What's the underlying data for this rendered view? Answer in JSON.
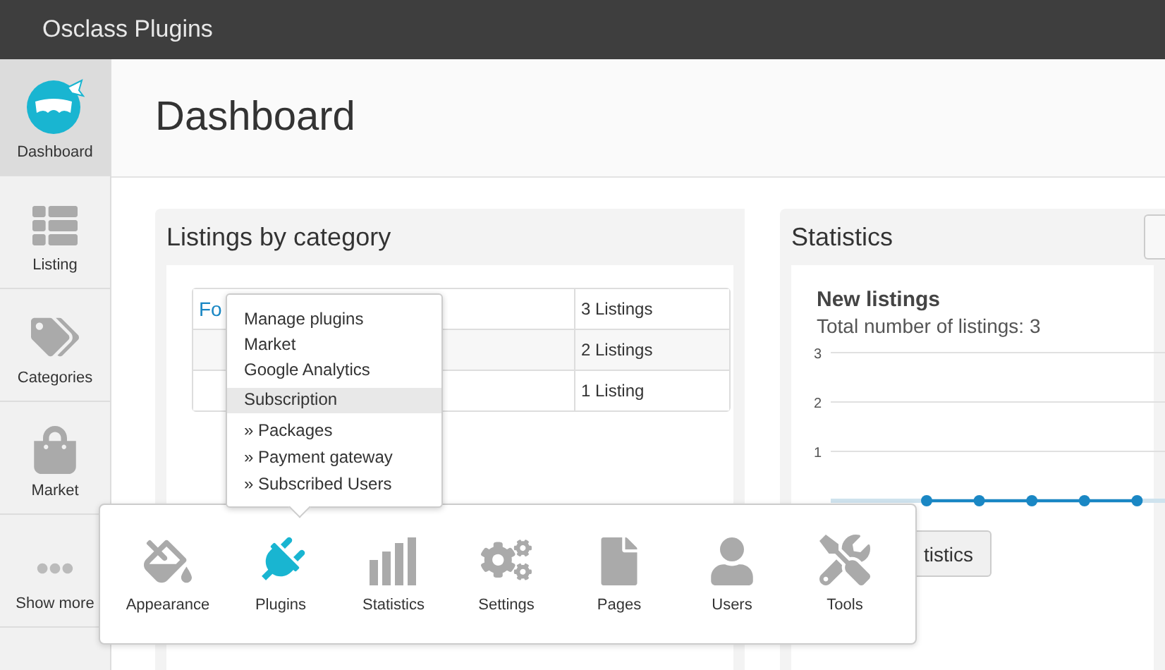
{
  "header": {
    "title": "Osclass Plugins"
  },
  "sidebar": {
    "items": [
      {
        "label": "Dashboard",
        "selected": true
      },
      {
        "label": "Listing",
        "selected": false
      },
      {
        "label": "Categories",
        "selected": false
      },
      {
        "label": "Market",
        "selected": false
      },
      {
        "label": "Show more",
        "selected": false
      }
    ]
  },
  "page_title": "Dashboard",
  "listings_panel": {
    "title": "Listings by category",
    "rows": [
      {
        "category": "Fo",
        "count": "3 Listings"
      },
      {
        "count": "2 Listings"
      },
      {
        "count": "1 Listing"
      }
    ]
  },
  "statistics_panel": {
    "title": "Statistics",
    "chart_title": "New listings",
    "chart_subtitle": "Total number of listings: 3",
    "button": "tistics",
    "chart_data": {
      "type": "line",
      "ylim": [
        0,
        3
      ],
      "yticks": [
        1,
        2,
        3
      ],
      "series": [
        {
          "color": "#1a87c4",
          "marker": "circle",
          "values": [
            0,
            0,
            0,
            0,
            0
          ]
        }
      ]
    }
  },
  "plugins_menu": {
    "items": [
      {
        "label": "Manage plugins",
        "kind": "item",
        "selected": false
      },
      {
        "label": "Market",
        "kind": "item",
        "selected": false
      },
      {
        "label": "Google Analytics",
        "kind": "item",
        "selected": false
      },
      {
        "label": "Subscription",
        "kind": "item",
        "selected": true
      },
      {
        "label": "» Packages",
        "kind": "subitem",
        "selected": false
      },
      {
        "label": "» Payment gateway",
        "kind": "subitem",
        "selected": false
      },
      {
        "label": "» Subscribed Users",
        "kind": "subitem",
        "selected": false
      }
    ]
  },
  "more_popup": {
    "items": [
      {
        "label": "Appearance",
        "selected": false
      },
      {
        "label": "Plugins",
        "selected": true
      },
      {
        "label": "Statistics",
        "selected": false
      },
      {
        "label": "Settings",
        "selected": false
      },
      {
        "label": "Pages",
        "selected": false
      },
      {
        "label": "Users",
        "selected": false
      },
      {
        "label": "Tools",
        "selected": false
      }
    ]
  }
}
